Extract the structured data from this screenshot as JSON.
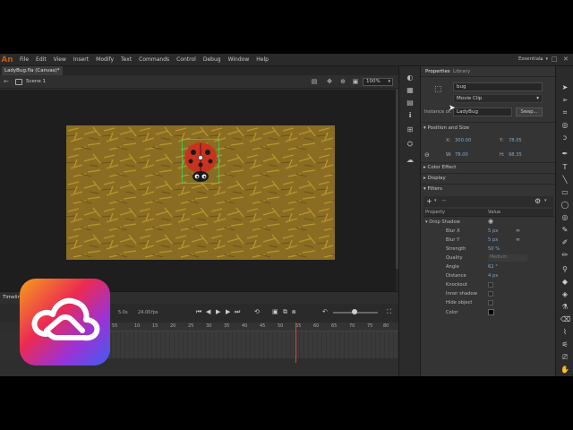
{
  "app": {
    "logo": "An",
    "workspace": "Essentials"
  },
  "menu": [
    "File",
    "Edit",
    "View",
    "Insert",
    "Modify",
    "Text",
    "Commands",
    "Control",
    "Debug",
    "Window",
    "Help"
  ],
  "document": {
    "tab": "LadyBug.fla (Canvas)*",
    "scene": "Scene 1",
    "zoom": "100%"
  },
  "timeline": {
    "tab": "Timeline",
    "fps": "24.00",
    "fps_unit": "fps",
    "time": "5.0s",
    "ruler": [
      "55",
      "10",
      "15",
      "20",
      "25",
      "30",
      "35",
      "40",
      "45",
      "50",
      "55",
      "60",
      "65",
      "70",
      "75",
      "80"
    ]
  },
  "properties": {
    "tabs": [
      "Properties",
      "Library"
    ],
    "instance_name": "bug",
    "symbol_type": "Movie Clip",
    "instance_of_label": "Instance of:",
    "instance_of": "LadyBug",
    "swap_label": "Swap...",
    "position_size": "Position and Size",
    "x_label": "X:",
    "x": "300.00",
    "y_label": "Y:",
    "y": "78.05",
    "w_label": "W:",
    "w": "78.00",
    "h_label": "H:",
    "h": "98.35",
    "color_effect": "Color Effect",
    "display": "Display",
    "filters": "Filters",
    "col_property": "Property",
    "col_value": "Value",
    "filter_name": "Drop Shadow",
    "filter_props": [
      {
        "name": "Blur X",
        "value": "5 px",
        "link": true
      },
      {
        "name": "Blur Y",
        "value": "5 px",
        "link": true
      },
      {
        "name": "Strength",
        "value": "50 %"
      },
      {
        "name": "Quality",
        "value": "Medium",
        "dim": true
      },
      {
        "name": "Angle",
        "value": "62 °"
      },
      {
        "name": "Distance",
        "value": "4 px"
      },
      {
        "name": "Knockout",
        "check": true
      },
      {
        "name": "Inner shadow",
        "check": true
      },
      {
        "name": "Hide object",
        "check": true
      },
      {
        "name": "Color",
        "swatch": "#000000"
      }
    ]
  },
  "colors": {
    "accent": "#4a8fd8",
    "stage": "#8a6d22",
    "ladybug": "#c8331f",
    "cc_gradient": [
      "#f59e1b",
      "#ec2a52",
      "#9b32d6",
      "#3e5ef0"
    ]
  }
}
